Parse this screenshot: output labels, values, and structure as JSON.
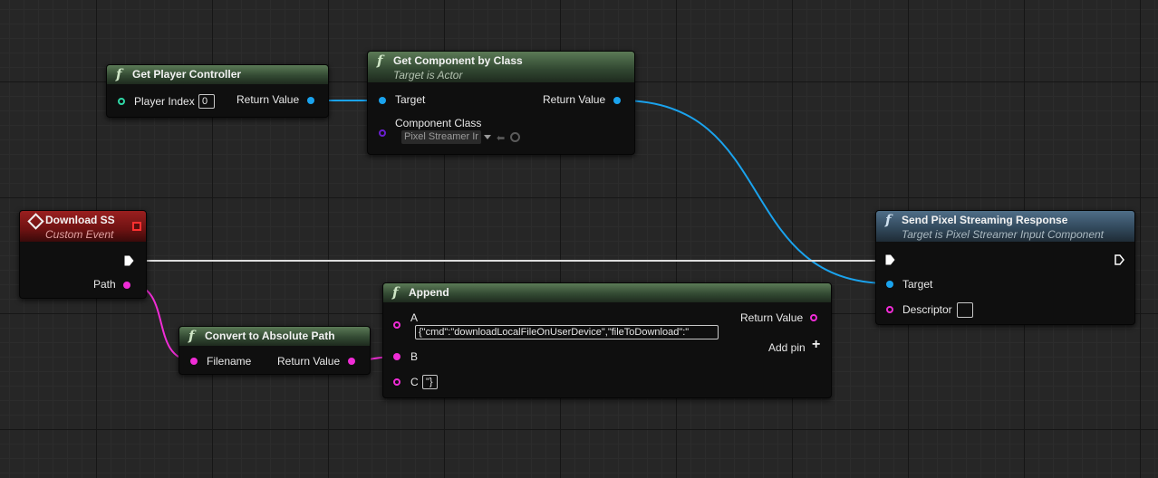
{
  "nodes": {
    "get_player_controller": {
      "title": "Get Player Controller",
      "player_index_label": "Player Index",
      "player_index_value": "0",
      "return_label": "Return Value"
    },
    "get_component_by_class": {
      "title": "Get Component by Class",
      "subtitle": "Target is Actor",
      "target_label": "Target",
      "return_label": "Return Value",
      "component_class_label": "Component Class",
      "component_class_value": "Pixel Streamer Ir"
    },
    "download_ss": {
      "title": "Download SS",
      "subtitle": "Custom Event",
      "path_label": "Path"
    },
    "send_response": {
      "title": "Send Pixel Streaming Response",
      "subtitle": "Target is Pixel Streamer Input Component",
      "target_label": "Target",
      "descriptor_label": "Descriptor"
    },
    "append": {
      "title": "Append",
      "a_label": "A",
      "a_value": "{\"cmd\":\"downloadLocalFileOnUserDevice\",\"fileToDownload\":\"",
      "b_label": "B",
      "c_label": "C",
      "c_value": "\"}",
      "return_label": "Return Value",
      "add_pin_label": "Add pin"
    },
    "convert_path": {
      "title": "Convert to Absolute Path",
      "filename_label": "Filename",
      "return_label": "Return Value"
    }
  },
  "colors": {
    "object_pin": "#1aa3ee",
    "string_pin": "#f02cd6",
    "int_pin": "#2fd7a6",
    "class_pin": "#6a1fd0",
    "exec_pin": "#ffffff"
  },
  "icons": {
    "function": "function-icon",
    "event": "event-icon",
    "exec": "exec-pin-icon",
    "add": "plus-icon"
  }
}
